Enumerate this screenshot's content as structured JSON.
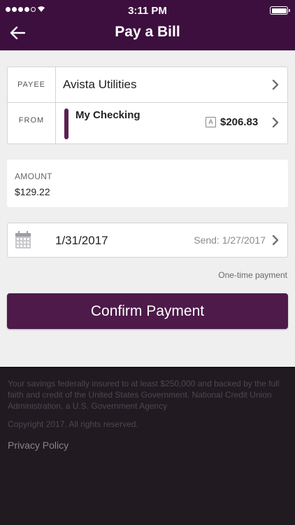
{
  "status_bar": {
    "time": "3:11 PM"
  },
  "header": {
    "title": "Pay a Bill"
  },
  "payee": {
    "label": "PAYEE",
    "value": "Avista Utilities"
  },
  "from": {
    "label": "FROM",
    "account_name": "My Checking",
    "badge": "A",
    "balance": "$206.83"
  },
  "amount": {
    "label": "AMOUNT",
    "value": "$129.22"
  },
  "date": {
    "value": "1/31/2017",
    "send_text": "Send: 1/27/2017"
  },
  "payment_type": "One-time payment",
  "confirm_label": "Confirm Payment",
  "footer": {
    "disclaimer": "Your savings federally insured to at least $250,000 and backed by the full faith and credit of the United States Government. National Credit Union Administration, a U.S. Government Agency",
    "copyright": "Copyright 2017. All rights reserved.",
    "privacy_link": "Privacy Policy"
  },
  "colors": {
    "header_bg": "#3d0f3e",
    "button_bg": "#4d1a4a",
    "account_accent": "#5a2050",
    "footer_bg": "#211a21"
  },
  "icons": {
    "back": "arrow-left-icon",
    "chevron": "chevron-right-icon",
    "calendar": "calendar-icon"
  }
}
